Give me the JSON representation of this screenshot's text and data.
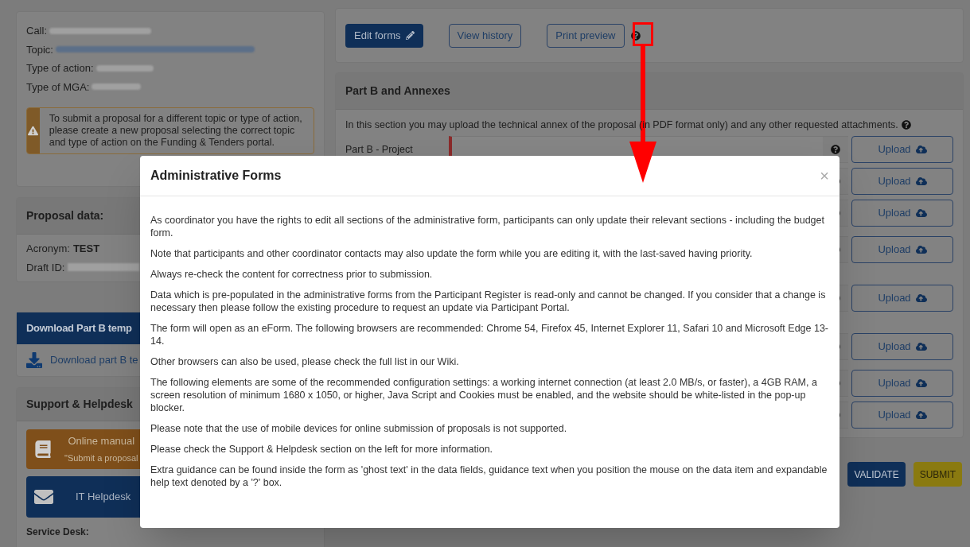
{
  "proposal_info": {
    "labels": [
      "Call:",
      "Topic:",
      "Type of action:",
      "Type of MGA:"
    ],
    "warning": "To submit a proposal for a different topic or type of action, please create a new proposal selecting the correct topic and type of action on the Funding & Tenders portal."
  },
  "proposal_data": {
    "title": "Proposal data:",
    "acronym_label": "Acronym:",
    "acronym": "TEST",
    "draft_label": "Draft ID:"
  },
  "download_panel": {
    "title": "Download Part B temp",
    "link": "Download part B te"
  },
  "support": {
    "title": "Support & Helpdesk",
    "manual": "Online manual",
    "manual_sub": "\"Submit a proposal",
    "helpdesk": "IT Helpdesk",
    "service_desk": "Service Desk:"
  },
  "toolbar": {
    "buttons": [
      {
        "label": "Edit forms",
        "kind": "primary"
      },
      {
        "label": "View history",
        "kind": "outline"
      },
      {
        "label": "Print preview",
        "kind": "outline"
      }
    ]
  },
  "part_b": {
    "title": "Part B and Annexes",
    "intro": "In this section you may upload the technical annex of the proposal (in PDF format only) and any other requested attachments.",
    "first_label": "Part B - Project",
    "rows": [
      "Upload",
      "Upload",
      "Upload",
      "Upload",
      "Upload",
      "Upload",
      "Upload",
      "Upload"
    ]
  },
  "actions": [
    {
      "label": "VALIDATE",
      "kind": "validate"
    },
    {
      "label": "SUBMIT",
      "kind": "submit"
    }
  ],
  "modal": {
    "title": "Administrative Forms",
    "close": "×",
    "paragraphs": [
      "As coordinator you have the rights to edit all sections of the administrative form, participants can only update their relevant sections - including the budget form.",
      "Note that participants and other coordinator contacts may also update the form while you are editing it, with the last-saved having priority.",
      "Always re-check the content for correctness prior to submission.",
      "Data which is pre-populated in the administrative forms from the Participant Register is read-only and cannot be changed. If you consider that a change is necessary then please follow the existing procedure to request an update via Participant Portal.",
      "The form will open as an eForm. The following browsers are recommended: Chrome 54, Firefox 45, Internet Explorer 11, Safari 10 and Microsoft Edge 13-14.",
      "Other browsers can also be used, please check the full list in our Wiki.",
      "The following elements are some of the recommended configuration settings: a working internet connection (at least 2.0 MB/s, or faster), a 4GB RAM, a screen resolution of minimum 1680 x 1050, or higher, Java Script and Cookies must be enabled, and the website should be white-listed in the pop-up blocker.",
      "Please note that the use of mobile devices for online submission of proposals is not supported.",
      "Please check the Support & Helpdesk section on the left for more information.",
      "Extra guidance can be found inside the form as 'ghost text' in the data fields, guidance text when you position the mouse on the data item and expandable help text denoted by a '?' box."
    ]
  }
}
